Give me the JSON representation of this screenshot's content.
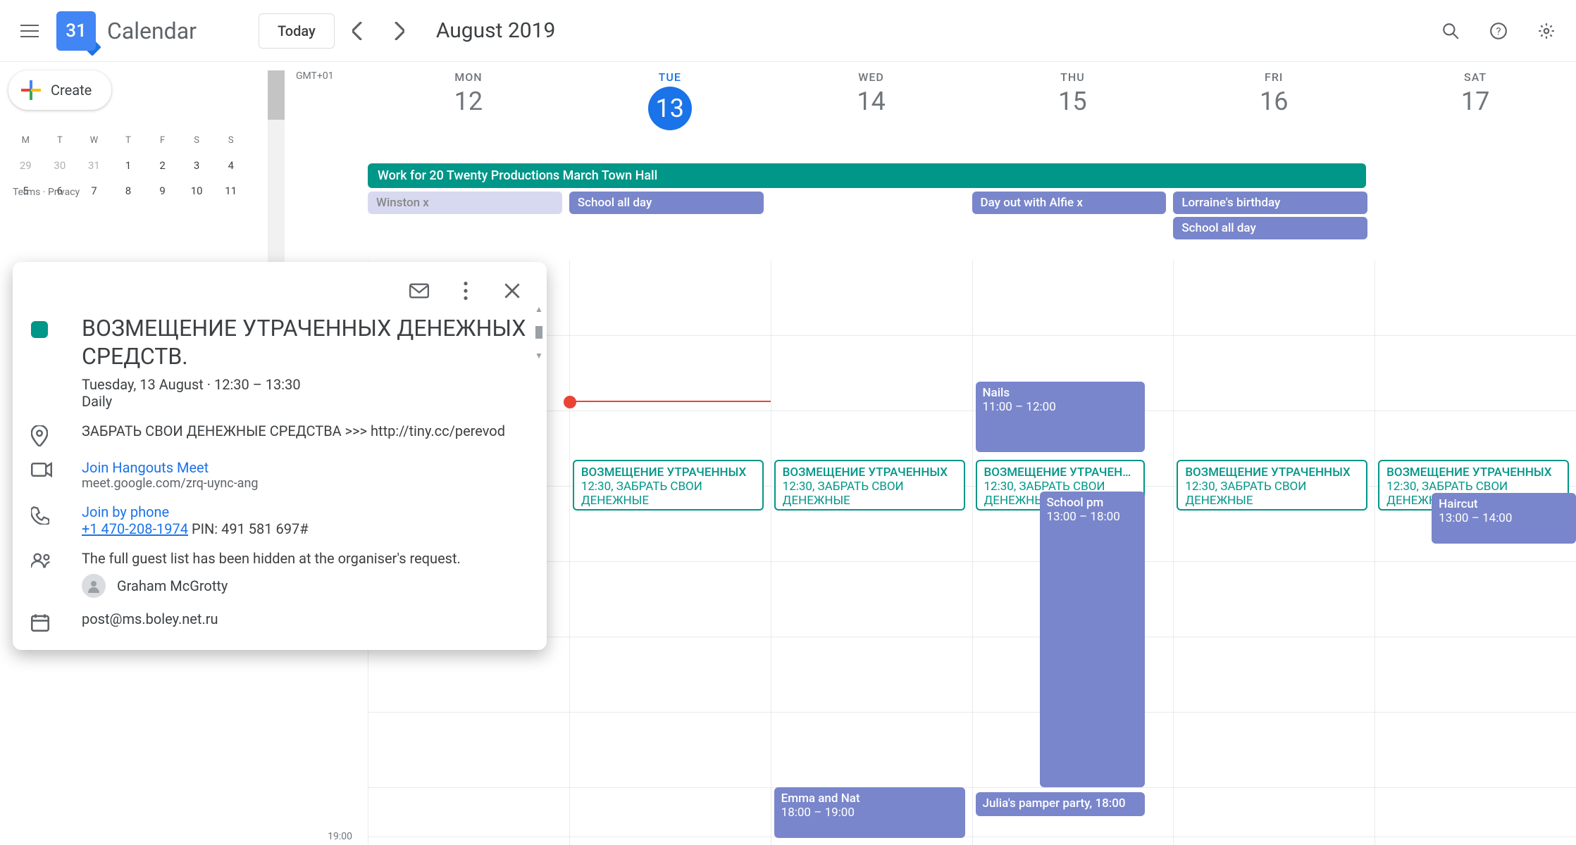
{
  "header": {
    "logo_day": "31",
    "app_title": "Calendar",
    "today_label": "Today",
    "month_label": "August 2019"
  },
  "sidebar": {
    "create_label": "Create",
    "mini_headers": [
      "M",
      "T",
      "W",
      "T",
      "F",
      "S",
      "S"
    ],
    "mini_rows": [
      [
        "29",
        "30",
        "31",
        "1",
        "2",
        "3",
        "4"
      ],
      [
        "5",
        "6",
        "7",
        "8",
        "9",
        "10",
        "11"
      ]
    ],
    "gmt": "GMT+01",
    "footer": "Terms · Privacy"
  },
  "days": [
    {
      "abbr": "MON",
      "num": "12",
      "today": false
    },
    {
      "abbr": "TUE",
      "num": "13",
      "today": true
    },
    {
      "abbr": "WED",
      "num": "14",
      "today": false
    },
    {
      "abbr": "THU",
      "num": "15",
      "today": false
    },
    {
      "abbr": "FRI",
      "num": "16",
      "today": false
    },
    {
      "abbr": "SAT",
      "num": "17",
      "today": false
    }
  ],
  "multiday_event": "Work for 20 Twenty Productions March Town Hall",
  "allday": {
    "mon": [
      "Winston x"
    ],
    "tue": [
      "School all day"
    ],
    "wed": [],
    "thu": [
      "Day out with Alfie x"
    ],
    "fri": [
      "Lorraine's birthday",
      "School all day"
    ],
    "sat": []
  },
  "spam": {
    "title": "ВОЗМЕЩЕНИЕ УТРАЧЕННЫХ",
    "sub": "12:30, ЗАБРАТЬ СВОИ ДЕНЕЖНЫЕ"
  },
  "events": {
    "nails_title": "Nails",
    "nails_time": "11:00 – 12:00",
    "schoolpm_title": "School pm",
    "schoolpm_time": "13:00 – 18:00",
    "emma_title": "Emma and Nat",
    "emma_time": "18:00 – 19:00",
    "julia": "Julia's pamper party, 18:00",
    "haircut_title": "Haircut",
    "haircut_time": "13:00 – 14:00"
  },
  "time_labels": {
    "t19": "19:00"
  },
  "popover": {
    "title": "ВОЗМЕЩЕНИЕ УТРАЧЕННЫХ ДЕНЕЖНЫХ СРЕДСТВ.",
    "date": "Tuesday, 13 August  ·  12:30 – 13:30",
    "recurrence": "Daily",
    "location": "ЗАБРАТЬ СВОИ ДЕНЕЖНЫЕ СРЕДСТВА >>> http://tiny.cc/perevod",
    "meet_label": "Join Hangouts Meet",
    "meet_url": "meet.google.com/zrq-uync-ang",
    "phone_label": "Join by phone",
    "phone_number": "+1 470-208-1974",
    "phone_pin": " PIN: 491 581 697#",
    "guests_note": "The full guest list has been hidden at the organiser's request.",
    "guest_name": "Graham McGrotty",
    "organiser_email": "post@ms.boley.net.ru"
  }
}
